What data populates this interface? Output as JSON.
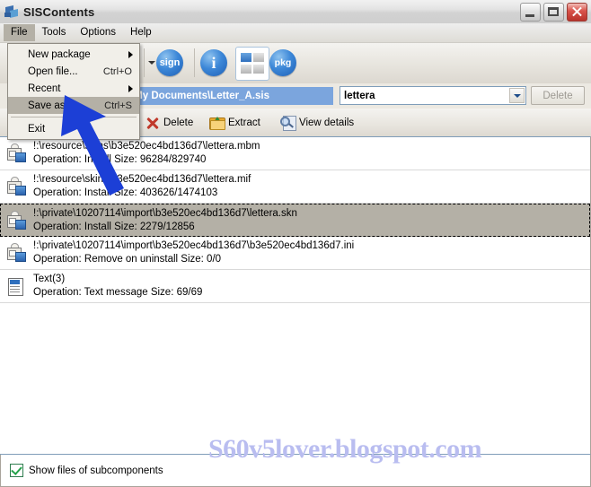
{
  "window": {
    "title": "SISContents",
    "icon": "app-icon",
    "buttons": {
      "minimize": "minimize",
      "maximize": "maximize",
      "close": "close"
    }
  },
  "menubar": {
    "items": [
      {
        "label": "File",
        "open": true
      },
      {
        "label": "Tools",
        "open": false
      },
      {
        "label": "Options",
        "open": false
      },
      {
        "label": "Help",
        "open": false
      }
    ]
  },
  "file_menu": {
    "items": [
      {
        "label": "New package",
        "shortcut": "",
        "submenu": true,
        "selected": false
      },
      {
        "label": "Open file...",
        "shortcut": "Ctrl+O",
        "submenu": false,
        "selected": false
      },
      {
        "label": "Recent",
        "shortcut": "",
        "submenu": true,
        "selected": false
      },
      {
        "label": "Save as...",
        "shortcut": "Ctrl+S",
        "submenu": false,
        "selected": true
      },
      {
        "label": "Exit",
        "shortcut": "",
        "submenu": false,
        "selected": false
      }
    ]
  },
  "toolbar": {
    "sign_label": "sign",
    "info_label": "i",
    "pkg_label": "pkg",
    "icons": [
      "dropdown-caret",
      "sign-button",
      "info-button",
      "components-button",
      "pkg-button"
    ]
  },
  "pathbar": {
    "path": "\\My Documents\\Letter_A.sis",
    "combo_value": "lettera",
    "delete_label": "Delete"
  },
  "actionbar": {
    "delete_label": "Delete",
    "extract_label": "Extract",
    "view_details_label": "View details"
  },
  "list": {
    "rows": [
      {
        "icon": "install-file-icon",
        "path": "!:\\resource\\skins\\b3e520ec4bd136d7\\lettera.mbm",
        "operation": "Operation: Install  Size: 96284/829740",
        "selected": false
      },
      {
        "icon": "install-file-icon",
        "path": "!:\\resource\\skins\\b3e520ec4bd136d7\\lettera.mif",
        "operation": "Operation: Install  Size: 403626/1474103",
        "selected": false
      },
      {
        "icon": "install-file-icon",
        "path": "!:\\private\\10207114\\import\\b3e520ec4bd136d7\\lettera.skn",
        "operation": "Operation: Install  Size: 2279/12856",
        "selected": true
      },
      {
        "icon": "install-file-icon",
        "path": "!:\\private\\10207114\\import\\b3e520ec4bd136d7\\b3e520ec4bd136d7.ini",
        "operation": "Operation: Remove on uninstall  Size: 0/0",
        "selected": false
      },
      {
        "icon": "text-message-icon",
        "path": "Text(3)",
        "operation": "Operation: Text message  Size: 69/69",
        "selected": false
      }
    ]
  },
  "footer": {
    "checkbox_label": "Show files of subcomponents",
    "checkbox_checked": true
  },
  "watermark": {
    "text": "S60v5lover.blogspot.com",
    "color": "#b9bdf0"
  },
  "annotation": {
    "type": "arrow",
    "color": "#1c3fd6"
  }
}
